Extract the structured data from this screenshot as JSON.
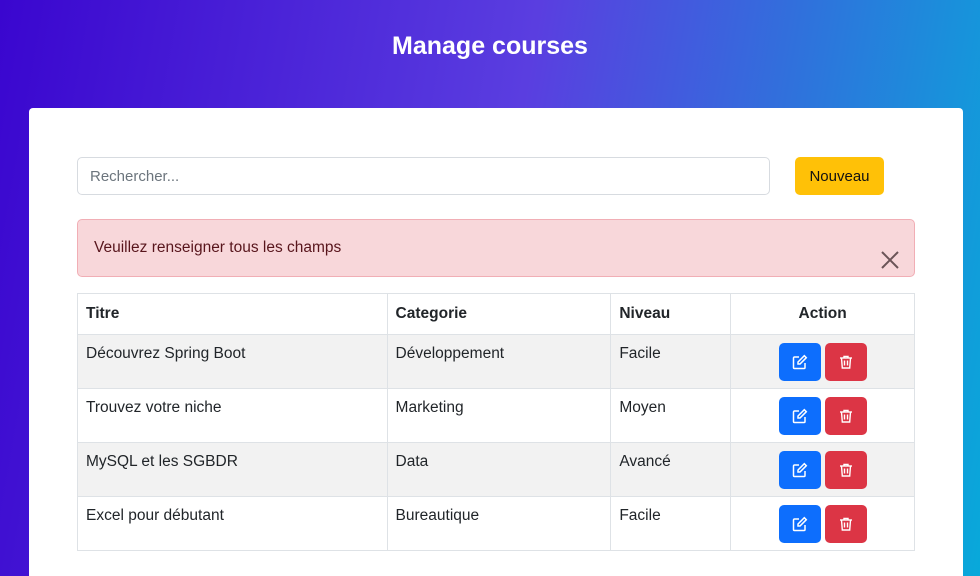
{
  "header": {
    "title": "Manage courses"
  },
  "search": {
    "placeholder": "Rechercher...",
    "value": ""
  },
  "toolbar": {
    "new_label": "Nouveau"
  },
  "alert": {
    "message": "Veuillez renseigner tous les champs"
  },
  "table": {
    "headers": {
      "title": "Titre",
      "category": "Categorie",
      "level": "Niveau",
      "action": "Action"
    },
    "rows": [
      {
        "title": "Découvrez Spring Boot",
        "category": "Développement",
        "level": "Facile"
      },
      {
        "title": "Trouvez votre niche",
        "category": "Marketing",
        "level": "Moyen"
      },
      {
        "title": "MySQL et les SGBDR",
        "category": "Data",
        "level": "Avancé"
      },
      {
        "title": "Excel pour débutant",
        "category": "Bureautique",
        "level": "Facile"
      }
    ]
  },
  "colors": {
    "edit": "#0d6efd",
    "delete": "#dc3545",
    "new_button": "#ffc107",
    "alert_bg": "#f8d7da"
  },
  "icons": {
    "edit": "edit-icon",
    "delete": "trash-icon",
    "close": "close-icon"
  }
}
